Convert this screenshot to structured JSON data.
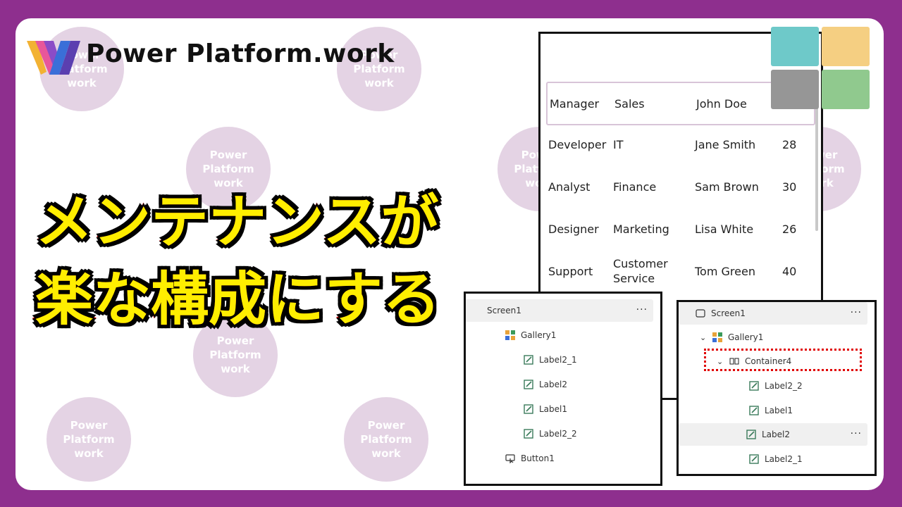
{
  "brand": {
    "name": "Power Platform.work"
  },
  "watermark": {
    "text": "Power\nPlatform\nwork"
  },
  "headline": {
    "line1": "メンテナンスが",
    "line2": "楽な構成にする"
  },
  "gallery": {
    "rows": [
      {
        "role": "Manager",
        "dept": "Sales",
        "name": "John Doe",
        "age": ""
      },
      {
        "role": "Developer",
        "dept": "IT",
        "name": "Jane Smith",
        "age": "28"
      },
      {
        "role": "Analyst",
        "dept": "Finance",
        "name": "Sam Brown",
        "age": "30"
      },
      {
        "role": "Designer",
        "dept": "Marketing",
        "name": "Lisa White",
        "age": "26"
      },
      {
        "role": "Support",
        "dept": "Customer\nService",
        "name": "Tom Green",
        "age": "40"
      }
    ],
    "partial_text": "s"
  },
  "swatches": {
    "colors": [
      "#6ec9c9",
      "#f5cf82",
      "#969696",
      "#90c98e"
    ]
  },
  "tree_left": {
    "screen": "Screen1",
    "gallery": "Gallery1",
    "items": [
      "Label2_1",
      "Label2",
      "Label1",
      "Label2_2"
    ],
    "button": "Button1",
    "more": "···"
  },
  "tree_right": {
    "screen": "Screen1",
    "gallery": "Gallery1",
    "container": "Container4",
    "items": [
      "Label2_2",
      "Label1",
      "Label2",
      "Label2_1"
    ],
    "more": "···"
  },
  "colors": {
    "background": "#8e2f8e",
    "headline_fill": "#ffee00",
    "headline_stroke": "#e00000",
    "highlight": "#e00000"
  }
}
